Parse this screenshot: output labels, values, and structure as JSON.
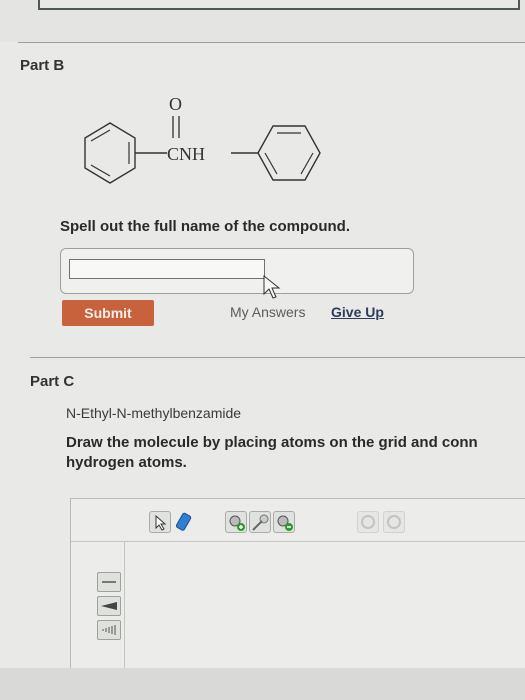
{
  "part_b": {
    "title": "Part B",
    "molecule": {
      "carbonyl_atom": "O",
      "linker_label": "CNH"
    },
    "prompt": "Spell out the full name of the compound.",
    "answer_value": "",
    "submit_label": "Submit",
    "my_answers_label": "My Answers",
    "give_up_label": "Give Up"
  },
  "part_c": {
    "title": "Part C",
    "compound_name": "N-Ethyl-N-methylbenzamide",
    "instruction_line1": "Draw the molecule by placing atoms on the grid and conn",
    "instruction_line2": "hydrogen atoms."
  },
  "colors": {
    "submit_bg": "#c7623d",
    "accent_green": "#2e9a2e",
    "accent_blue": "#2f7fd3"
  }
}
